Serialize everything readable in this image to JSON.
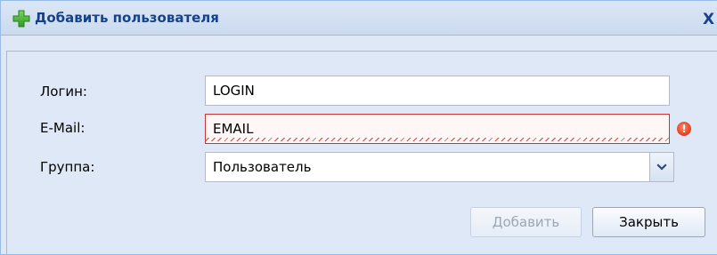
{
  "window": {
    "title": "Добавить пользователя",
    "close_label": "X"
  },
  "form": {
    "login": {
      "label": "Логин:",
      "value": "LOGIN"
    },
    "email": {
      "label": "E-Mail:",
      "value": "EMAIL"
    },
    "group": {
      "label": "Группа:",
      "value": "Пользователь"
    }
  },
  "buttons": {
    "add_label": "Добавить",
    "close_label": "Закрыть"
  },
  "icons": {
    "title_icon": "plus-icon",
    "error_icon": "error-icon",
    "dropdown_icon": "chevron-down-icon"
  },
  "colors": {
    "header_title": "#15428b",
    "error": "#cc3333",
    "accent": "#99bbe8"
  }
}
